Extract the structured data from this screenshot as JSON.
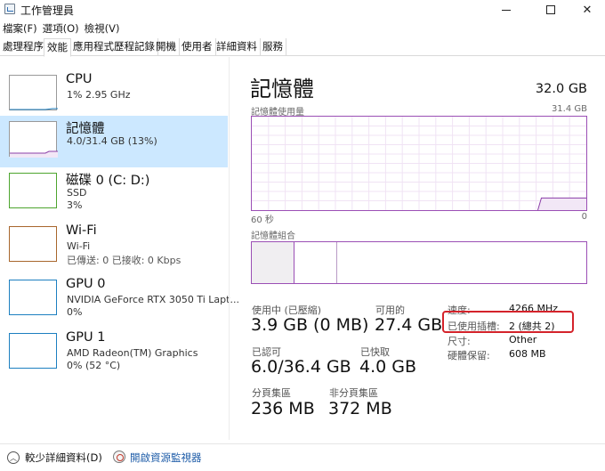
{
  "window": {
    "title": "工作管理員",
    "minimize_glyph": "—",
    "close_glyph": "✕"
  },
  "menu": [
    "檔案(F)",
    "選項(O)",
    "檢視(V)"
  ],
  "tabs": [
    "處理程序",
    "效能",
    "應用程式歷程記錄",
    "開機",
    "使用者",
    "詳細資料",
    "服務"
  ],
  "active_tab": "效能",
  "sidebar": [
    {
      "title": "CPU",
      "line1": "1%  2.95 GHz",
      "line2": "",
      "accent": "#1c7fc0",
      "icon": "cpu-graph-icon"
    },
    {
      "title": "記憶體",
      "line1": "4.0/31.4 GB (13%)",
      "line2": "",
      "accent": "#8b3fa8",
      "icon": "memory-graph-icon"
    },
    {
      "title": "磁碟 0 (C: D:)",
      "line1": "SSD",
      "line2": "3%",
      "accent": "#4da52e",
      "icon": "disk-graph-icon"
    },
    {
      "title": "Wi-Fi",
      "line1": "Wi-Fi",
      "line2": "已傳送: 0  已接收: 0 Kbps",
      "accent": "#a8662c",
      "icon": "wifi-graph-icon"
    },
    {
      "title": "GPU 0",
      "line1": "NVIDIA GeForce RTX 3050 Ti Lapt...",
      "line2": "0%",
      "accent": "#1c7fc0",
      "icon": "gpu0-graph-icon"
    },
    {
      "title": "GPU 1",
      "line1": "AMD Radeon(TM) Graphics",
      "line2": "0% (52 °C)",
      "accent": "#1c7fc0",
      "icon": "gpu1-graph-icon"
    }
  ],
  "memory": {
    "title": "記憶體",
    "total": "32.0 GB",
    "usage_label": "記憶體使用量",
    "usage_max": "31.4 GB",
    "time_left": "60 秒",
    "time_right": "0",
    "usage_fraction": 0.13,
    "composition_label": "記憶體組合",
    "accent": "#8b3fa8",
    "stats": {
      "in_use_label": "使用中 (已壓縮)",
      "in_use_value": "3.9 GB (0 MB)",
      "available_label": "可用的",
      "available_value": "27.4 GB",
      "committed_label": "已認可",
      "committed_value": "6.0/36.4 GB",
      "cached_label": "已快取",
      "cached_value": "4.0 GB",
      "paged_label": "分頁集區",
      "paged_value": "236 MB",
      "nonpaged_label": "非分頁集區",
      "nonpaged_value": "372 MB"
    },
    "props": {
      "speed_label": "速度:",
      "speed_value": "4266 MHz",
      "slots_label": "已使用插槽:",
      "slots_value": "2 (總共 2)",
      "form_label": "尺寸:",
      "form_value": "Other",
      "reserved_label": "硬體保留:",
      "reserved_value": "608 MB"
    }
  },
  "footer": {
    "fewer_details": "較少詳細資料(D)",
    "open_monitor": "開啟資源監視器"
  }
}
